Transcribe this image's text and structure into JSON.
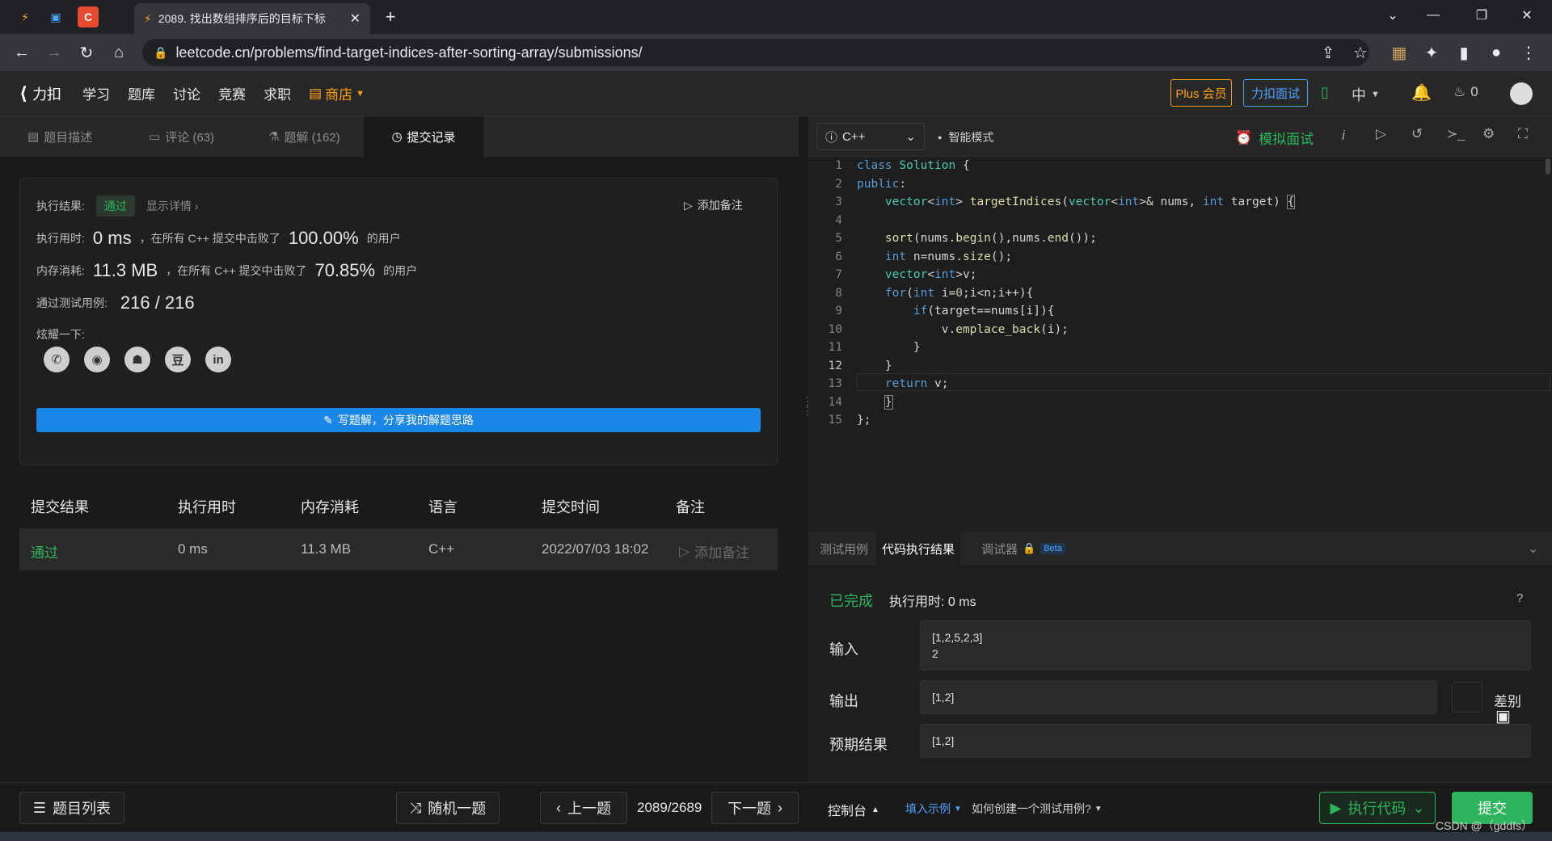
{
  "browser": {
    "tab_title": "2089. 找出数组排序后的目标下标",
    "url": "leetcode.cn/problems/find-target-indices-after-sorting-array/submissions/"
  },
  "header": {
    "logo": "力扣",
    "menu": [
      "学习",
      "题库",
      "讨论",
      "竞赛",
      "求职"
    ],
    "store": "商店",
    "plus": "Plus 会员",
    "interview": "力扣面试",
    "lang": "中",
    "points": "0"
  },
  "left_tabs": {
    "desc": "题目描述",
    "comments": "评论 (63)",
    "solutions": "题解 (162)",
    "submissions": "提交记录"
  },
  "result": {
    "label_result": "执行结果:",
    "status": "通过",
    "details": "显示详情",
    "add_note": "添加备注",
    "label_time": "执行用时:",
    "time": "0 ms",
    "time_text": "，在所有 C++ 提交中击败了",
    "time_pct": "100.00%",
    "users": "的用户",
    "label_mem": "内存消耗:",
    "mem": "11.3 MB",
    "mem_text": "，在所有 C++ 提交中击败了",
    "mem_pct": "70.85%",
    "label_tests": "通过测试用例:",
    "tests": "216 / 216",
    "label_share": "炫耀一下:",
    "share_icons": [
      "wechat-icon",
      "weibo-icon",
      "qq-icon",
      "douban-icon",
      "linkedin-icon"
    ],
    "write_btn": "写题解，分享我的解题思路"
  },
  "table": {
    "headers": [
      "提交结果",
      "执行用时",
      "内存消耗",
      "语言",
      "提交时间",
      "备注"
    ],
    "row": {
      "status": "通过",
      "time": "0 ms",
      "mem": "11.3 MB",
      "lang": "C++",
      "date": "2022/07/03 18:02",
      "note": "添加备注"
    }
  },
  "editor": {
    "language": "C++",
    "mode": "智能模式",
    "mock": "模拟面试",
    "line_numbers": [
      "1",
      "2",
      "3",
      "4",
      "5",
      "6",
      "7",
      "8",
      "9",
      "10",
      "11",
      "12",
      "13",
      "14",
      "15"
    ]
  },
  "console": {
    "tabs": [
      "测试用例",
      "代码执行结果",
      "调试器"
    ],
    "beta": "Beta",
    "done": "已完成",
    "exec_label": "执行用时: 0 ms",
    "input_label": "输入",
    "input_line1": "[1,2,5,2,3]",
    "input_line2": "2",
    "output_label": "输出",
    "output": "[1,2]",
    "diff": "差别",
    "expected_label": "预期结果",
    "expected": "[1,2]"
  },
  "bottom": {
    "list": "题目列表",
    "random": "随机一题",
    "prev": "上一题",
    "counter": "2089/2689",
    "next": "下一题",
    "console": "控制台",
    "fill": "填入示例",
    "how": "如何创建一个测试用例?",
    "run": "执行代码",
    "submit": "提交",
    "watermark": "CSDN @（gddfs）"
  },
  "colors": {
    "accent": "#1a86e8",
    "success": "#2db55d",
    "orange": "#ffa116"
  }
}
